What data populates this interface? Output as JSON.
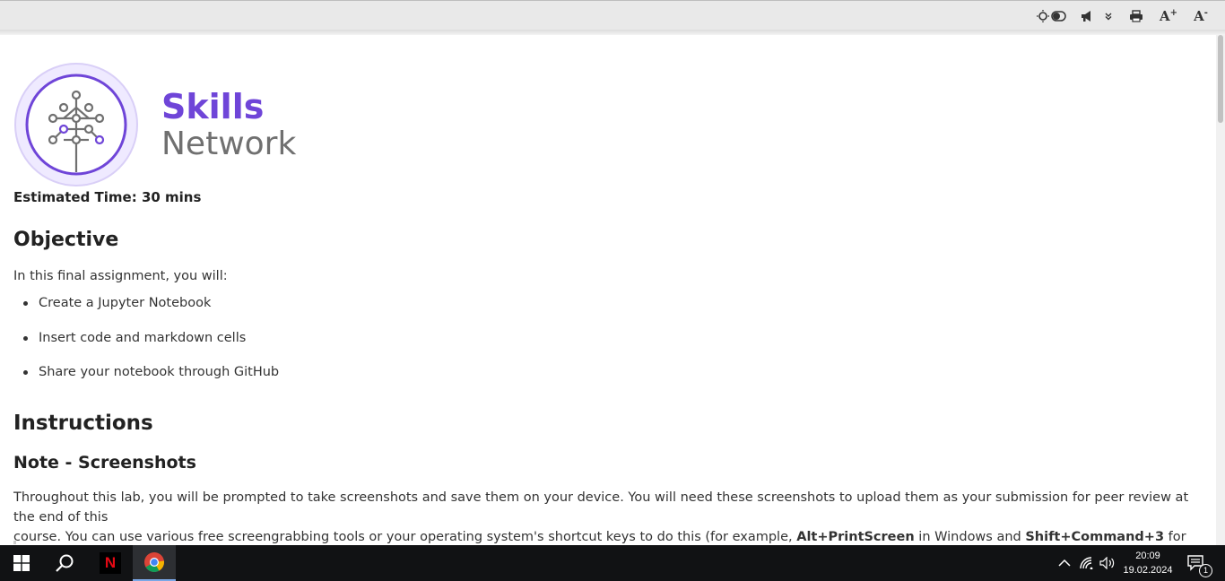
{
  "toolbar": {
    "items": [
      {
        "name": "theme-toggle-icon"
      },
      {
        "name": "announcement-icon"
      },
      {
        "name": "chevron-down-icon"
      },
      {
        "name": "print-icon"
      },
      {
        "name": "font-increase-icon",
        "label": "A",
        "sup": "+"
      },
      {
        "name": "font-decrease-icon",
        "label": "A",
        "sup": "-"
      }
    ]
  },
  "logo": {
    "line1": "Skills",
    "line2": "Network",
    "line1_color": "#6f45d8",
    "line2_color": "#707070"
  },
  "estimated_time": "Estimated Time: 30 mins",
  "objective": {
    "heading": "Objective",
    "intro": "In this final assignment, you will:",
    "items": [
      "Create a Jupyter Notebook",
      "Insert code and markdown cells",
      "Share your notebook through GitHub"
    ]
  },
  "instructions": {
    "heading": "Instructions"
  },
  "note": {
    "heading": "Note - Screenshots",
    "text1": "Throughout this lab, you will be prompted to take screenshots and save them on your device. You will need these screenshots to upload them as your submission for peer review at the end of this",
    "text2_pre": "course. You can use various free screengrabbing tools or your operating system's shortcut keys to do this (for example, ",
    "key1": "Alt+PrintScreen",
    "text2_mid": " in Windows and ",
    "key2": "Shift+Command+3",
    "text2_post": " for Mac)."
  },
  "taskbar": {
    "apps": [
      {
        "name": "start-icon"
      },
      {
        "name": "search-icon"
      },
      {
        "name": "netflix-app-icon",
        "label": "N"
      },
      {
        "name": "chrome-app-icon",
        "active": true
      }
    ],
    "time": "20:09",
    "date": "19.02.2024",
    "notification_count": "1"
  }
}
